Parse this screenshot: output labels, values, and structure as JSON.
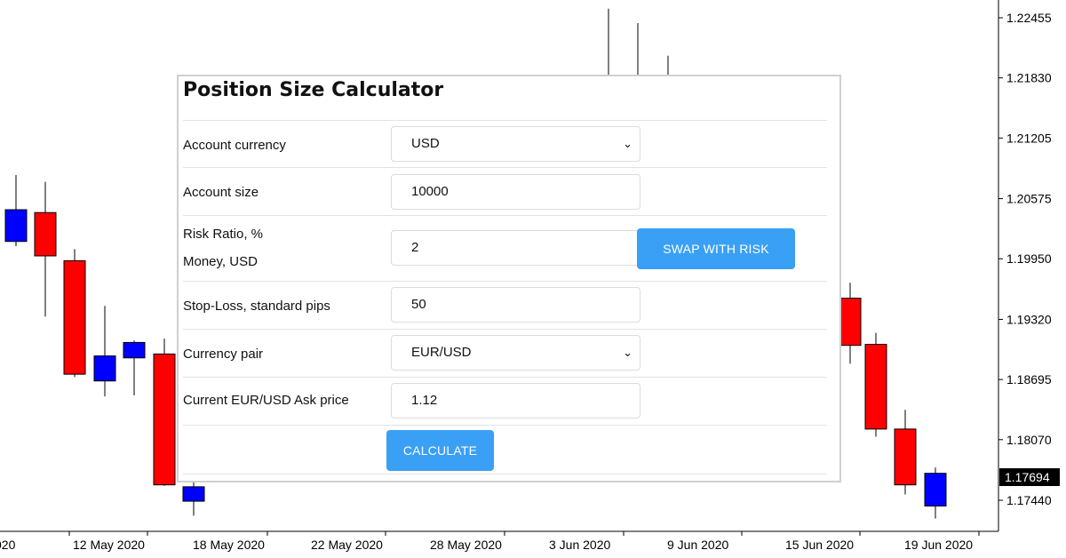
{
  "chart_data": {
    "type": "candlestick",
    "y_ticks": [
      "1.22455",
      "1.21830",
      "1.21205",
      "1.20575",
      "1.19950",
      "1.19320",
      "1.18695",
      "1.18070",
      "1.17440"
    ],
    "x_ticks": [
      "020",
      "12 May 2020",
      "18 May 2020",
      "22 May 2020",
      "28 May 2020",
      "3 Jun 2020",
      "9 Jun 2020",
      "15 Jun 2020",
      "19 Jun 2020"
    ],
    "current_price": "1.17694",
    "up_color": "#0000ff",
    "down_color": "#ff0000",
    "candles": [
      {
        "open": 1.2013,
        "high": 1.2082,
        "low": 1.2008,
        "close": 1.2046
      },
      {
        "open": 1.2043,
        "high": 1.2075,
        "low": 1.1935,
        "close": 1.1998
      },
      {
        "open": 1.1993,
        "high": 1.2005,
        "low": 1.1872,
        "close": 1.1875
      },
      {
        "open": 1.1868,
        "high": 1.1946,
        "low": 1.1852,
        "close": 1.1894
      },
      {
        "open": 1.1892,
        "high": 1.191,
        "low": 1.1853,
        "close": 1.1908
      },
      {
        "open": 1.1896,
        "high": 1.1912,
        "low": 1.1759,
        "close": 1.176
      },
      {
        "open": 1.1743,
        "high": 1.178,
        "low": 1.1728,
        "close": 1.1758
      },
      {
        "open": 1.2165,
        "high": 1.2255,
        "low": 1.2165,
        "close": 1.2185
      },
      {
        "open": 1.218,
        "high": 1.224,
        "low": 1.218,
        "close": 1.2185
      },
      {
        "open": 1.218,
        "high": 1.2206,
        "low": 1.218,
        "close": 1.2185
      },
      {
        "open": 1.1954,
        "high": 1.197,
        "low": 1.1886,
        "close": 1.1905
      },
      {
        "open": 1.1906,
        "high": 1.1918,
        "low": 1.181,
        "close": 1.1818
      },
      {
        "open": 1.1818,
        "high": 1.1838,
        "low": 1.175,
        "close": 1.176
      },
      {
        "open": 1.1738,
        "high": 1.1778,
        "low": 1.1725,
        "close": 1.1772
      }
    ]
  },
  "calculator": {
    "title": "Position Size Calculator",
    "rows": [
      {
        "label": "Account currency",
        "value": "USD"
      },
      {
        "label": "Account size",
        "value": "10000"
      },
      {
        "label": "Risk Ratio, %",
        "label2": "Money, USD",
        "value": "2"
      },
      {
        "label": "Stop-Loss, standard pips",
        "value": "50"
      },
      {
        "label": "Currency pair",
        "value": "EUR/USD"
      },
      {
        "label": "Current EUR/USD Ask price",
        "value": "1.12"
      }
    ],
    "swap_button": "SWAP WITH RISK",
    "calculate_button": "CALCULATE"
  }
}
